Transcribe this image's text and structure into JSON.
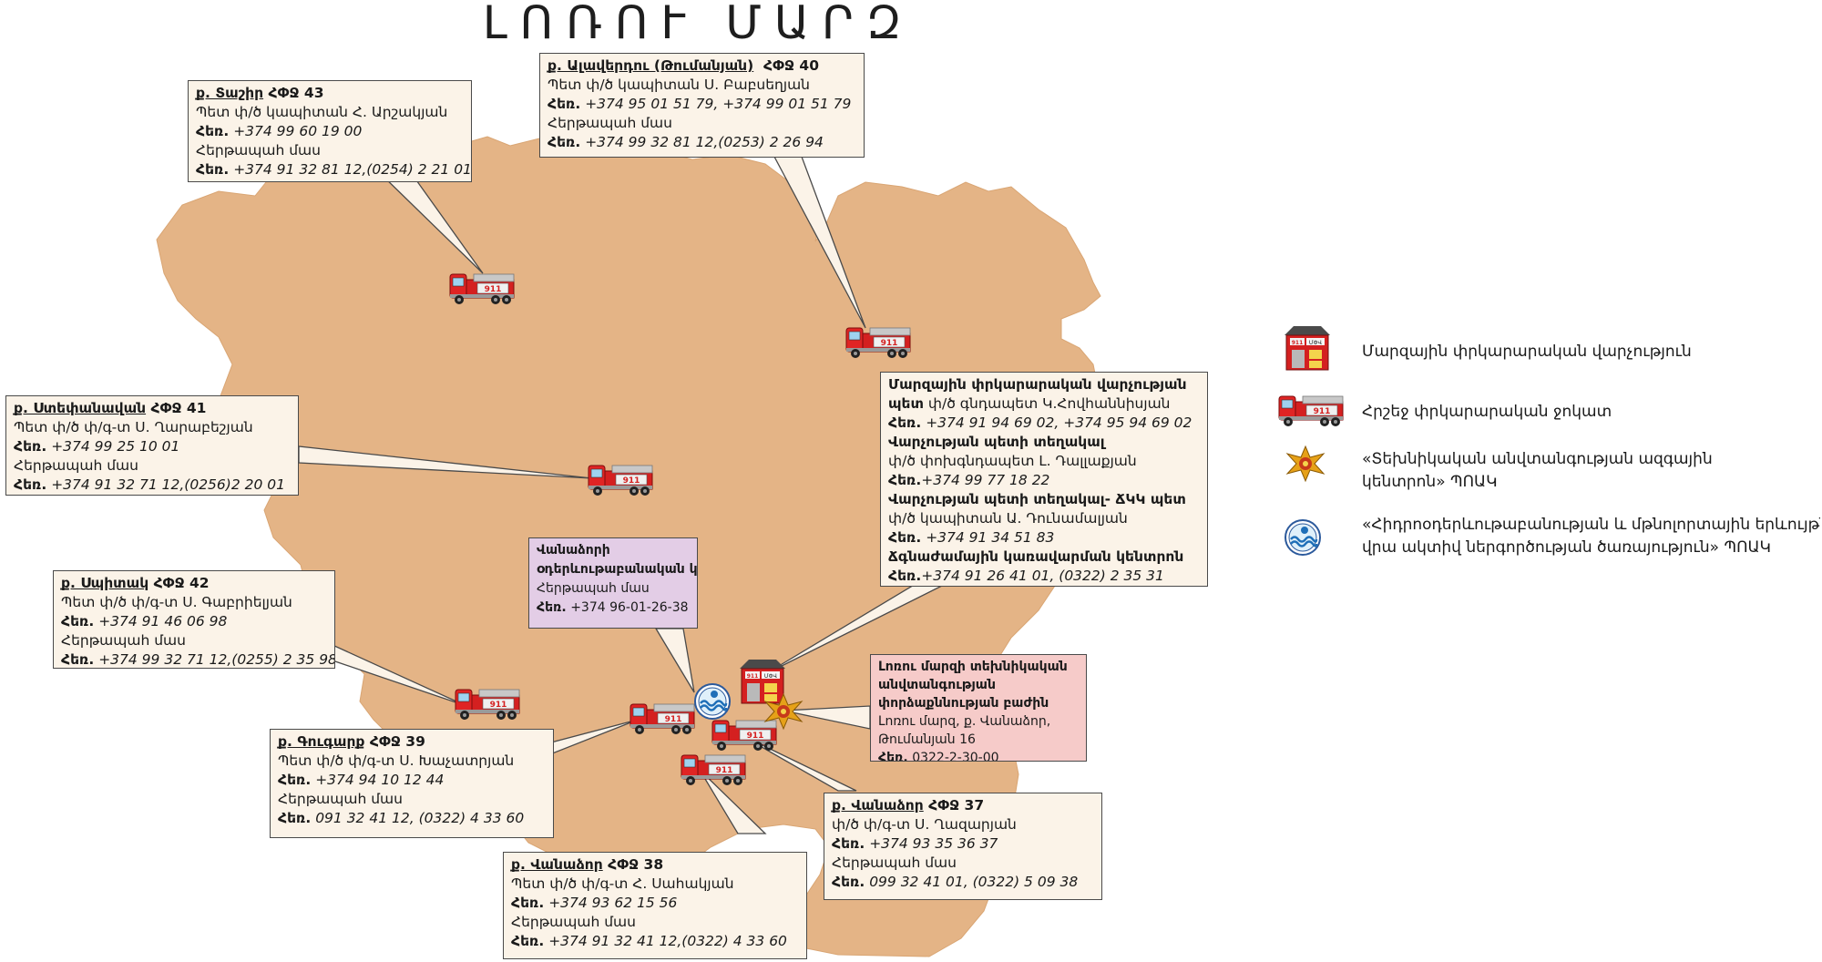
{
  "title": "ԼՈՌՈՒ ՄԱՐԶ",
  "colors": {
    "region_fill": "#e4b486",
    "box_bg": "#fbf3e8",
    "meteo_box_bg": "#e3cde6",
    "dept_box_bg": "#f6cbc9",
    "truck_red": "#d42020"
  },
  "boxes": {
    "tashir": {
      "city": "ք. Տաշիր",
      "unit": "ՀՓՋ 43",
      "lines": [
        "Պետ փ/ծ կապիտան Հ. Արշակյան",
        "+374 99 60 19 00",
        "Հերթապահ մաս",
        "+374 91 32 81 12,(0254) 2 21 01"
      ]
    },
    "alaverdi": {
      "city": "ք. Ալավերդու (Թումանյան)",
      "unit": "ՀՓՋ 40",
      "lines": [
        "Պետ փ/ծ կապիտան Ս. Բաբսեղյան",
        "+374 95 01 51 79, +374 99 01 51 79",
        "Հերթապահ մաս",
        "+374 99 32 81 12,(0253) 2 26 94"
      ]
    },
    "stepanavan": {
      "city": "ք. Ստեփանավան",
      "unit": "ՀՓՋ 41",
      "lines": [
        "Պետ փ/ծ  փ/գ-տ Ս. Ղարաբեշյան",
        "+374 99 25 10 01",
        "Հերթապահ մաս",
        "+374 91 32 71 12,(0256)2 20 01"
      ]
    },
    "spitak": {
      "city": "ք. Սպիտակ",
      "unit": "ՀՓՋ 42",
      "lines": [
        "Պետ փ/ծ փ/գ-տ Ս. Գաբրիելյան",
        "+374 91 46 06 98",
        "Հերթապահ մաս",
        "+374 99 32 71 12,(0255) 2 35 98"
      ]
    },
    "gugark": {
      "city": "ք. Գուգարք",
      "unit": "ՀՓՋ 39",
      "lines": [
        "Պետ փ/ծ փ/գ-տ Ս. Խաչատրյան",
        "+374 94 10 12 44",
        "Հերթապահ մաս",
        "091 32 41 12, (0322) 4 33 60"
      ]
    },
    "vanadzor38": {
      "city": "ք. Վանաձոր",
      "unit": "ՀՓՋ 38",
      "lines": [
        "Պետ փ/ծ փ/գ-տ Հ. Սահակյան",
        "+374 93 62 15 56",
        "Հերթապահ մաս",
        "+374 91 32 41 12,(0322) 4 33 60"
      ]
    },
    "vanadzor37": {
      "city": "ք. Վանաձոր",
      "unit": "ՀՓՋ 37",
      "lines": [
        "փ/ծ փ/գ-տ Ս. Ղազարյան",
        "+374 93 35 36 37",
        "Հերթապահ մաս",
        "099 32 41 01, (0322) 5 09 38"
      ]
    },
    "meteo": {
      "title1": "Վանաձորի",
      "title2": "օդերևութաբանական կայան",
      "line1": "Հերթապահ մաս",
      "phone": "+374 96-01-26-38"
    },
    "rescue_dept": {
      "h1": "Մարզային փրկարարական վարչության",
      "h2": "պետ",
      "p1": "փ/ծ գնդապետ Կ.Հովհաննիսյան",
      "ph1": "+374 91 94 69 02, +374 95 94 69 02",
      "h3": "Վարչության պետի տեղակալ",
      "p2": "փ/ծ փոխգնդապետ Լ. Դալլաքյան",
      "ph2": "+374 99 77 18 22",
      "h4": "Վարչության պետի տեղակալ- ՃԿԿ պետ",
      "p3": "փ/ծ կապիտան Ա. Դունամալյան",
      "ph3": "+374 91 34 51 83",
      "h5": "Ճգնաժամային կառավարման կենտրոն",
      "ph4": "+374 91 26 41 01, (0322)  2 35 31"
    },
    "tech_safety": {
      "h1": "Լոռու մարզի տեխնիկական",
      "h2": "անվտանգության",
      "h3": "փորձաքննության բաժին",
      "a1": "Լոռու մարզ, ք. Վանաձոր,",
      "a2": "Թումանյան 16",
      "phone": "0322-2-30-00"
    }
  },
  "phone_label": "Հեռ.",
  "legend": [
    {
      "icon": "rescue-department-building-icon",
      "text": "Մարզային փրկարարական վարչություն"
    },
    {
      "icon": "fire-truck-icon",
      "text": "Հրշեջ փրկարարական ջոկատ"
    },
    {
      "icon": "technical-safety-emblem-icon",
      "text": "«Տեխնիկական անվտանգության ազգային կենտրոն» ՊՈԱԿ"
    },
    {
      "icon": "hydrometeorology-emblem-icon",
      "text": "«Հիդրոօդերևութաբանության և մթնոլորտային երևույթների վրա ակտիվ ներգործության ծառայություն» ՊՈԱԿ"
    }
  ],
  "legend_lines": {
    "l3a": "«Տեխնիկական անվտանգության ազգային",
    "l3b": "կենտրոն» ՊՈԱԿ",
    "l4a": "«Հիդրոօդերևութաբանության և մթնոլորտային երևույթների",
    "l4b": "վրա ակտիվ ներգործության ծառայություն» ՊՈԱԿ"
  },
  "truck_label": "911",
  "building_label": "ՄՓՎ"
}
